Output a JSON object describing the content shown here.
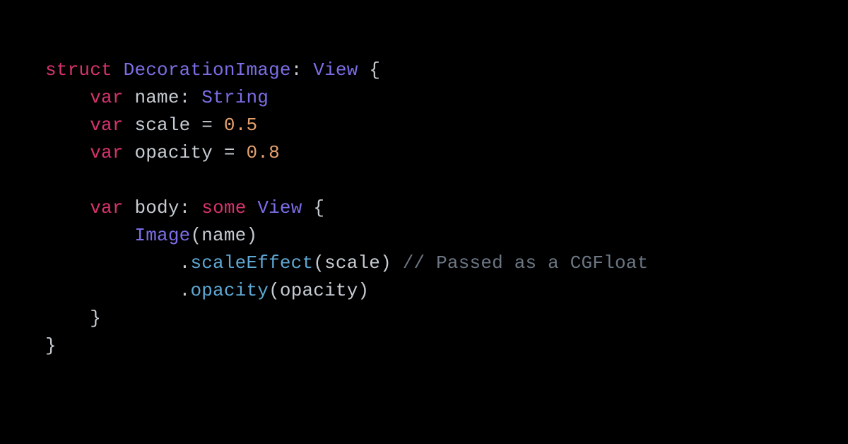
{
  "code": {
    "t_struct": "struct",
    "t_var": "var",
    "t_some": "some",
    "type_DecorationImage": "DecorationImage",
    "type_View": "View",
    "type_String": "String",
    "type_Image": "Image",
    "id_name": "name",
    "id_scale": "scale",
    "id_opacity": "opacity",
    "id_body": "body",
    "num_scale": "0.5",
    "num_opacity": "0.8",
    "m_scaleEffect": "scaleEffect",
    "m_opacity": "opacity",
    "comment_passed": "// Passed as a CGFloat",
    "p_colon_sp": ": ",
    "p_sp_eq_sp": " = ",
    "p_sp_lbrace": " {",
    "p_lparen": "(",
    "p_rparen": ")",
    "p_rparen_sp": ") ",
    "p_dot": ".",
    "p_rbrace": "}",
    "indent1": "    ",
    "indent2": "        ",
    "indent3": "            ",
    "sp": " "
  }
}
